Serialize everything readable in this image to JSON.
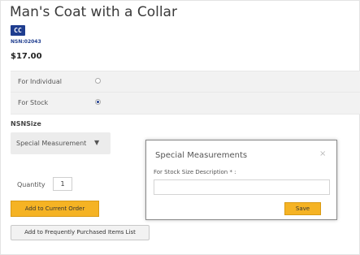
{
  "product": {
    "title": "Man's Coat with a Collar",
    "badge": "CC",
    "nsn": "NSN:02043",
    "price": "$17.00"
  },
  "options": [
    {
      "label": "For Individual",
      "selected": false
    },
    {
      "label": "For Stock",
      "selected": true
    }
  ],
  "size": {
    "heading": "NSNSize",
    "selected": "Special Measurement",
    "caret": "▼"
  },
  "quantity": {
    "label": "Quantity",
    "value": "1"
  },
  "buttons": {
    "add_to_order": "Add to Current Order",
    "add_to_favorites": "Add to Frequently Purchased Items List"
  },
  "modal": {
    "title": "Special Measurements",
    "close": "×",
    "field_label": "For Stock Size Description * :",
    "field_value": "",
    "save": "Save"
  },
  "colors": {
    "accent": "#f5b324",
    "brand": "#1f3d8f"
  }
}
